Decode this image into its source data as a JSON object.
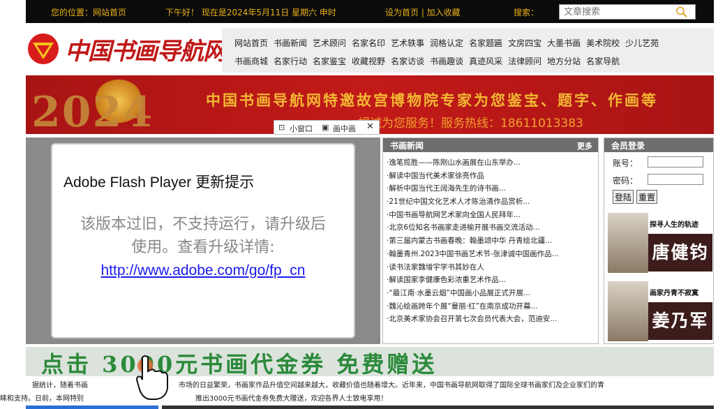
{
  "topbar": {
    "location": "您的位置：网站首页",
    "greeting": "下午好！ 现在是2024年5月11日 星期六 申时",
    "links": "设为首页 | 加入收藏",
    "search_label": "搜索：",
    "search_placeholder": "文章搜索"
  },
  "logo": {
    "text": "中国书画导航网"
  },
  "menu": {
    "row1": [
      "网站首页",
      "书画新闻",
      "艺术顾问",
      "名家名印",
      "艺术轶事",
      "润格认定",
      "名家题匾",
      "文房四宝",
      "大墨书画",
      "美术院校",
      "少儿艺苑"
    ],
    "row2": [
      "书画商城",
      "名家行动",
      "名家鉴宝",
      "收藏视野",
      "名家访谈",
      "书画趣谈",
      "真迹风采",
      "法律顾问",
      "地方分站",
      "名家导航"
    ]
  },
  "banner": {
    "year": "2024",
    "title": "中国书画导航网特邀故宫博物院专家为您鉴宝、题字、作画等",
    "subtitle": "竭诚为您服务！服务热线：18611013383"
  },
  "popin": {
    "small_window": "小窗口",
    "pip": "画中画",
    "close": "✕"
  },
  "flash": {
    "title": "Adobe Flash Player 更新提示",
    "line1": "该版本过旧，不支持运行，请升级后",
    "line2": "使用。查看升级详情:",
    "link": "http://www.adobe.com/go/fp_cn"
  },
  "news": {
    "title": "书画新闻",
    "more": "更多",
    "items": [
      "·逸笔揽胜——陈刚山水画展在山东举办...",
      "·解读中国当代美术家徐亮作品",
      "·解析中国当代王阔海先生的诗书画...",
      "·21世纪中国文化艺术人才陈治清作品赏析...",
      "·中国书画导航网艺术家向全国人民拜年...",
      "·北京6位知名书画家走进榆开展书画交流活动...",
      "·第三届内蒙古书画春晚：翰墨颂中华 丹青绘北疆...",
      "·翰墨青州.2023中国书画艺术节-张津诚中国画作品...",
      "·读书法家魏增宇学书其妙在人",
      "·解读国家李健康色彩浓重艺术作品...",
      "·“最江南·水墨云烟”中国画小品展正式开展...",
      "·魏沁绘画跨年个展“曼丽·红”在南京成功开幕...",
      "·北京美术家协会召开第七次会员代表大会，范迪安..."
    ]
  },
  "member": {
    "title": "会员登录",
    "account_label": "账号：",
    "password_label": "密码：",
    "login_btn": "登陆",
    "reset_btn": "重置"
  },
  "promos": [
    {
      "caption": "探寻人生的轨迹",
      "name": "唐健钧"
    },
    {
      "caption": "画家丹青不寂寞",
      "name": "姜乃军"
    }
  ],
  "strip": {
    "text": "点击   3000元书画代金券  免费赠送"
  },
  "footer": {
    "line1a": "据统计，随着书画",
    "line1b": "市场的日益繁荣，书画家作品升值空间越来越大，收藏价值也随着增大。近年来，中国书画导航网取得了国际全球书画家们及企业家们的青",
    "line2a": "睐和支持。日前，本网特别",
    "line2b": "推出3000元书画代金券免费大赠送，欢迎各界人士致电享用！"
  }
}
